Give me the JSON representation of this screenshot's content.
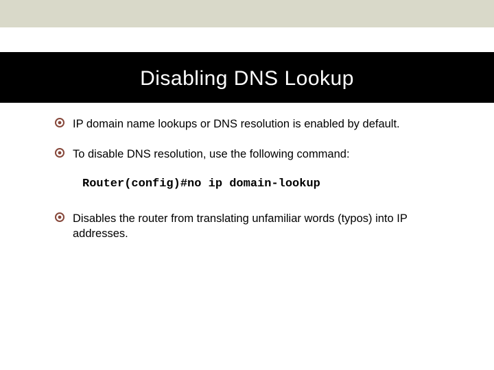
{
  "title": "Disabling DNS Lookup",
  "bullets": {
    "0": "IP domain name lookups or DNS resolution is enabled by default.",
    "1": "To disable DNS resolution, use the following command:",
    "2": "Disables the router from translating unfamiliar words (typos) into IP addresses."
  },
  "command": "Router(config)#no ip domain-lookup",
  "colors": {
    "topBand": "#d9d9c9",
    "titleBand": "#000000",
    "bulletAccent": "#86473a"
  }
}
